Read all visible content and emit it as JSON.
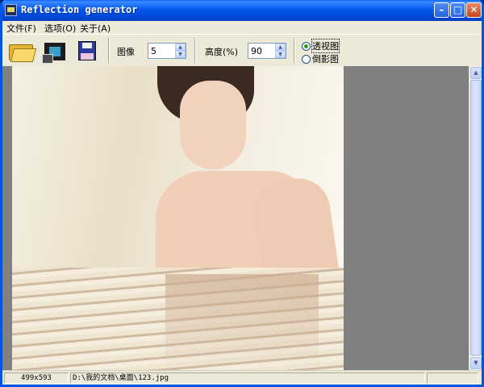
{
  "window": {
    "title": "Reflection generator"
  },
  "title_buttons": {
    "minimize": "–",
    "maximize": "□",
    "close": "✕"
  },
  "menu": [
    "文件(F)",
    "选项(O)",
    "关于(A)"
  ],
  "toolbar": {
    "image_label": "图像",
    "image_value": "5",
    "height_label": "高度(%)",
    "height_value": "90",
    "mode_options": [
      "透视图",
      "倒影图"
    ],
    "mode_selected": "透视图",
    "icons": [
      "open-folder-icon",
      "video-icon",
      "save-floppy-icon"
    ]
  },
  "statusbar": {
    "size": "499x593",
    "path": "D:\\我的文档\\桌面\\123.jpg"
  }
}
